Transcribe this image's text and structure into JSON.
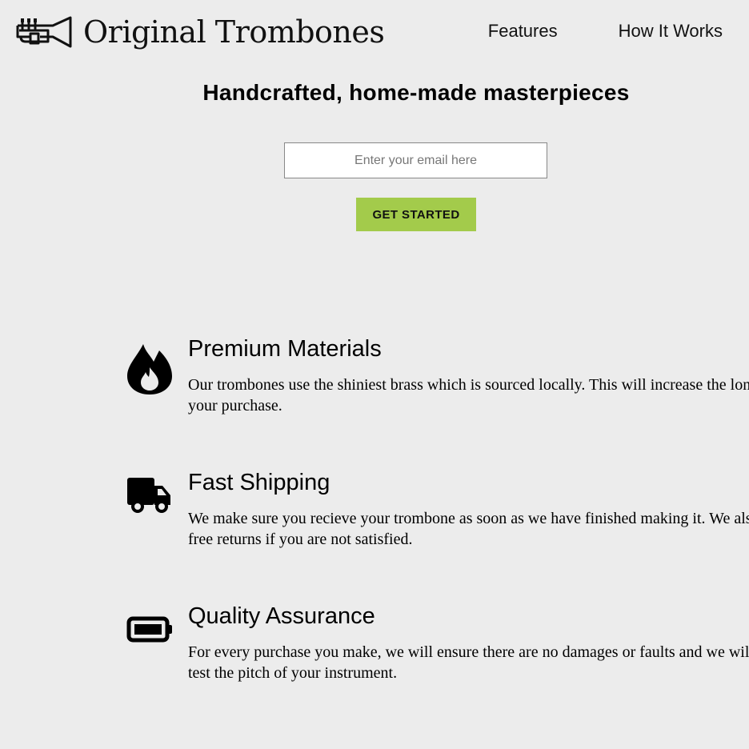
{
  "header": {
    "brand": "Original Trombones",
    "logo_icon": "trumpet-icon",
    "nav": [
      {
        "label": "Features"
      },
      {
        "label": "How It Works"
      }
    ]
  },
  "hero": {
    "headline": "Handcrafted, home-made masterpieces",
    "email_placeholder": "Enter your email here",
    "cta_label": "GET STARTED",
    "cta_color": "#a3cb4b"
  },
  "features": [
    {
      "icon": "fire-icon",
      "title": "Premium Materials",
      "text": "Our trombones use the shiniest brass which is sourced locally. This will increase the longevity of your purchase."
    },
    {
      "icon": "truck-icon",
      "title": "Fast Shipping",
      "text": "We make sure you recieve your trombone as soon as we have finished making it. We also provide free returns if you are not satisfied."
    },
    {
      "icon": "battery-full-icon",
      "title": "Quality Assurance",
      "text": "For every purchase you make, we will ensure there are no damages or faults and we will check and test the pitch of your instrument."
    }
  ]
}
